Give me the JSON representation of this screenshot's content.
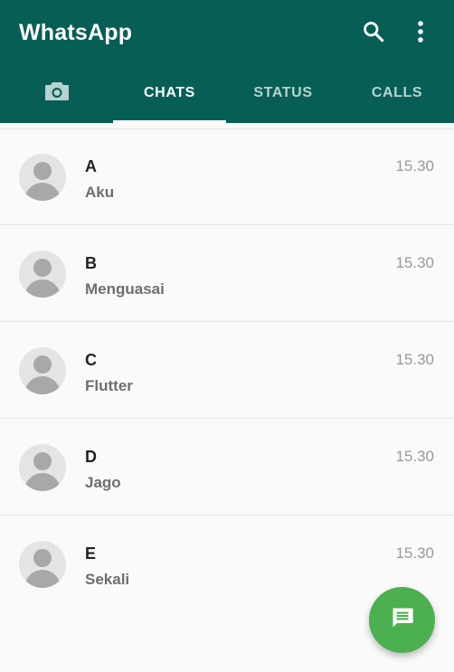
{
  "app": {
    "title": "WhatsApp",
    "accent_color": "#075e54",
    "fab_color": "#4caf50"
  },
  "header": {
    "actions": [
      {
        "icon": "search-icon"
      },
      {
        "icon": "more-vert-icon"
      }
    ]
  },
  "tabs": [
    {
      "icon": "camera-icon",
      "label": ""
    },
    {
      "label": "CHATS",
      "selected": true
    },
    {
      "label": "STATUS"
    },
    {
      "label": "CALLS"
    }
  ],
  "chats": [
    {
      "name": "A",
      "message": "Aku",
      "time": "15.30"
    },
    {
      "name": "B",
      "message": "Menguasai",
      "time": "15.30"
    },
    {
      "name": "C",
      "message": "Flutter",
      "time": "15.30"
    },
    {
      "name": "D",
      "message": "Jago",
      "time": "15.30"
    },
    {
      "name": "E",
      "message": "Sekali",
      "time": "15.30"
    }
  ],
  "fab": {
    "icon": "message-icon"
  }
}
